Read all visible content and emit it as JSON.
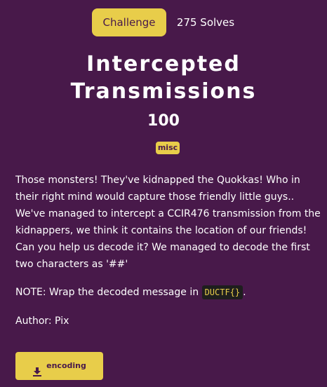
{
  "tabs": {
    "challenge_label": "Challenge",
    "solves_label": "275 Solves"
  },
  "challenge": {
    "title_line1": "Intercepted",
    "title_line2": "Transmissions",
    "points": "100",
    "category": "misc",
    "description": [
      "Those monsters! They've kidnapped the Quokkas! Who in",
      "their right mind would capture those friendly little guys..",
      "We've managed to intercept a CCIR476 transmission from the",
      "kidnappers, we think it contains the location of our friends!",
      "Can you help us decode it? We managed to decode the first",
      "two characters as '##'"
    ],
    "note_prefix": "NOTE: Wrap the decoded message in ",
    "note_code": "DUCTF{}",
    "note_suffix": ".",
    "author": "Author: Pix"
  },
  "files": {
    "download_label": "encoding",
    "download_icon": "download-icon"
  },
  "colors": {
    "background": "#48194a",
    "accent": "#e8cd4a",
    "text": "#ffffff"
  }
}
